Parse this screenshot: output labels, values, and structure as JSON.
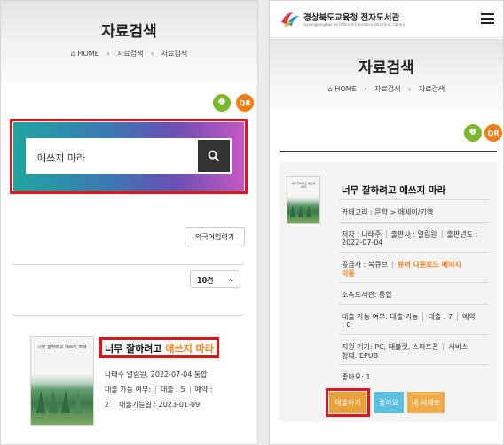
{
  "left": {
    "page_title": "자료검색",
    "breadcrumb": [
      "HOME",
      "자료검색",
      "자료검색"
    ],
    "print_label": "🖶",
    "qr_label": "QR",
    "search_value": "애쓰지 마라",
    "foreign_input_label": "외국어입력기",
    "page_size_label": "10건",
    "result": {
      "title_main": "너무 잘하려고",
      "title_highlight": "애쓰지 마라",
      "author_line": "나태주 열림원, 2022-07-04 통합",
      "loan_status_label": "대출 가능 여부:",
      "loan_label": "대출 : 5",
      "reserve_label": "예약 :",
      "reserve_count": "2",
      "available_date": "대출가능일 : 2023-01-09"
    },
    "cover_text": "너무 잘하려고 애쓰지 마라"
  },
  "right": {
    "org_name": "경상북도교육청 전자도서관",
    "org_subtitle": "Gyeongsangbuk-do Office of Education Electronic Library",
    "page_title": "자료검색",
    "breadcrumb": [
      "HOME",
      "자료검색",
      "자료검색"
    ],
    "print_label": "🖶",
    "qr_label": "QR",
    "book": {
      "title": "너무 잘하려고 애쓰지 마라",
      "category": "카테고리 : 문학 > 에세이/기행",
      "author": "저자 : 나태주",
      "publisher": "출판사 : 열림원",
      "pubyear_label": "출판년도 :",
      "pubyear": "2022-07-04",
      "supplier": "공급사 : 북큐브",
      "viewer_link_1": "뷰어 다운로드 페이지",
      "viewer_link_2": "이동",
      "library": "소속도서관: 통합",
      "loan_status_label": "대출 가능 여부: 대출 가능",
      "loan_count": "대출 : 7",
      "reserve_label": "예약",
      "reserve_count": ": 0",
      "devices_1": "지원 기기: PC, 태블릿, 스마트폰",
      "devices_service": "서비스",
      "devices_2": "형태: EPUB",
      "likes": "좋아요: 1"
    },
    "buttons": {
      "borrow": "대출하기",
      "like": "좋아요",
      "shelf": "내 서재로"
    },
    "cover_text": "너무 잘하려고 애쓰지 마라"
  },
  "colors": {
    "highlight_red": "#e3141b",
    "accent_orange": "#f07d16",
    "print_green": "#7bb72f",
    "borrow_bg": "#e8a33a",
    "like_bg": "#5bc0de",
    "shelf_bg": "#f0ad4e"
  }
}
